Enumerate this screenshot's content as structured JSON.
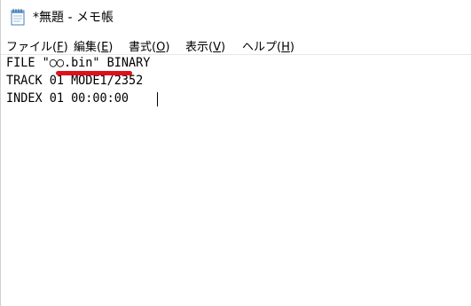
{
  "window": {
    "title": "*無題 - メモ帳",
    "icon": "notepad-icon"
  },
  "menu": {
    "file": {
      "label": "ファイル(",
      "mnemonic": "F",
      "close": ")"
    },
    "edit": {
      "label": "編集(",
      "mnemonic": "E",
      "close": ")"
    },
    "format": {
      "label": "書式(",
      "mnemonic": "O",
      "close": ")"
    },
    "view": {
      "label": "表示(",
      "mnemonic": "V",
      "close": ")"
    },
    "help": {
      "label": "ヘルプ(",
      "mnemonic": "H",
      "close": ")"
    }
  },
  "editor": {
    "lines": [
      "FILE \"○○.bin\" BINARY",
      "TRACK 01 MODE1/2352",
      "INDEX 01 00:00:00"
    ],
    "annotation_color": "#e0101a"
  }
}
